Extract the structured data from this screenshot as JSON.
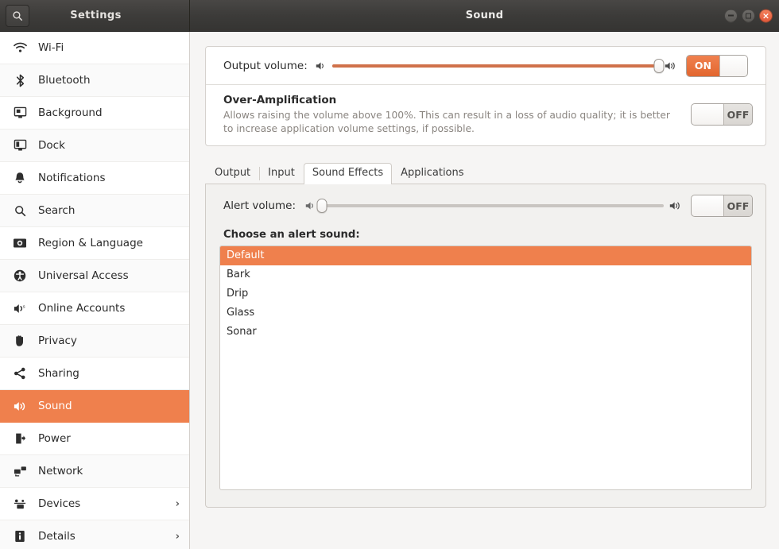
{
  "titlebar": {
    "search_icon": "search-icon",
    "settings_title": "Settings",
    "window_title": "Sound",
    "controls": {
      "minimize": "minimize-button",
      "maximize": "maximize-button",
      "close": "×"
    }
  },
  "colors": {
    "accent": "#ef804d",
    "slider_fill": "#d0714a",
    "toggle_on": "#e2662f",
    "sidebar_bg": "#ffffff",
    "content_bg": "#f6f5f4",
    "titlebar_bg": "#3c3b39"
  },
  "sidebar": {
    "items": [
      {
        "label": "Wi-Fi",
        "icon": "wifi-icon",
        "active": false,
        "chevron": ""
      },
      {
        "label": "Bluetooth",
        "icon": "bluetooth-icon",
        "active": false,
        "chevron": ""
      },
      {
        "label": "Background",
        "icon": "background-icon",
        "active": false,
        "chevron": ""
      },
      {
        "label": "Dock",
        "icon": "dock-icon",
        "active": false,
        "chevron": ""
      },
      {
        "label": "Notifications",
        "icon": "bell-icon",
        "active": false,
        "chevron": ""
      },
      {
        "label": "Search",
        "icon": "search-icon",
        "active": false,
        "chevron": ""
      },
      {
        "label": "Region & Language",
        "icon": "region-language-icon",
        "active": false,
        "chevron": ""
      },
      {
        "label": "Universal Access",
        "icon": "accessibility-icon",
        "active": false,
        "chevron": ""
      },
      {
        "label": "Online Accounts",
        "icon": "online-accounts-icon",
        "active": false,
        "chevron": ""
      },
      {
        "label": "Privacy",
        "icon": "hand-icon",
        "active": false,
        "chevron": ""
      },
      {
        "label": "Sharing",
        "icon": "share-icon",
        "active": false,
        "chevron": ""
      },
      {
        "label": "Sound",
        "icon": "speaker-icon",
        "active": true,
        "chevron": ""
      },
      {
        "label": "Power",
        "icon": "power-icon",
        "active": false,
        "chevron": ""
      },
      {
        "label": "Network",
        "icon": "network-icon",
        "active": false,
        "chevron": ""
      },
      {
        "label": "Devices",
        "icon": "devices-icon",
        "active": false,
        "chevron": "›"
      },
      {
        "label": "Details",
        "icon": "info-icon",
        "active": false,
        "chevron": "›"
      }
    ]
  },
  "output_volume": {
    "label": "Output volume:",
    "left_icon": "speaker-low-icon",
    "right_icon": "speaker-high-icon",
    "value": 100,
    "min": 0,
    "max": 100,
    "toggle_state": "ON"
  },
  "over_amplification": {
    "title": "Over-Amplification",
    "description": "Allows raising the volume above 100%. This can result in a loss of audio quality; it is better to increase application volume settings, if possible.",
    "toggle_state": "OFF"
  },
  "tabs": [
    {
      "label": "Output",
      "active": false
    },
    {
      "label": "Input",
      "active": false
    },
    {
      "label": "Sound Effects",
      "active": true
    },
    {
      "label": "Applications",
      "active": false
    }
  ],
  "sound_effects": {
    "alert_volume": {
      "label": "Alert volume:",
      "left_icon": "speaker-low-icon",
      "right_icon": "speaker-high-icon",
      "value": 0,
      "min": 0,
      "max": 100,
      "toggle_state": "OFF"
    },
    "choose_label": "Choose an alert sound:",
    "alert_sounds": [
      {
        "label": "Default",
        "selected": true
      },
      {
        "label": "Bark",
        "selected": false
      },
      {
        "label": "Drip",
        "selected": false
      },
      {
        "label": "Glass",
        "selected": false
      },
      {
        "label": "Sonar",
        "selected": false
      }
    ]
  }
}
